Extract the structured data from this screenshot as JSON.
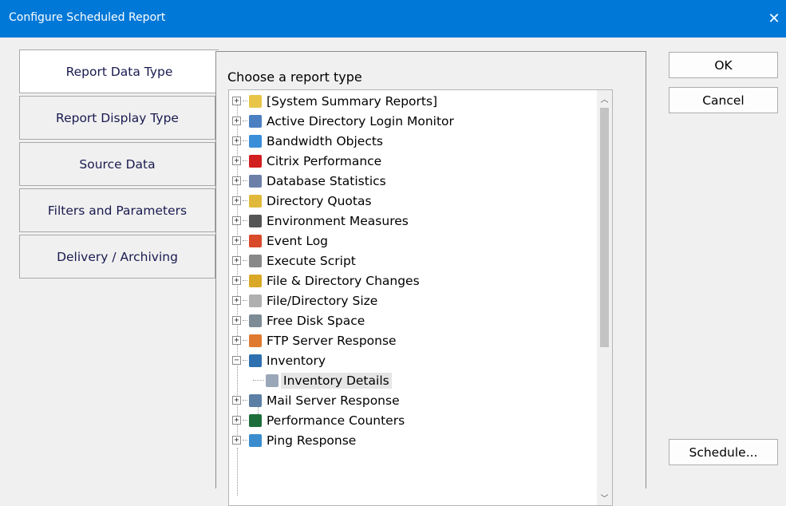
{
  "window": {
    "title": "Configure Scheduled Report"
  },
  "tabs": [
    {
      "label": "Report Data Type",
      "active": true
    },
    {
      "label": "Report Display Type",
      "active": false
    },
    {
      "label": "Source Data",
      "active": false
    },
    {
      "label": "Filters and Parameters",
      "active": false
    },
    {
      "label": "Delivery / Archiving",
      "active": false
    }
  ],
  "panel": {
    "heading": "Choose a report type"
  },
  "tree": {
    "items": [
      {
        "label": "[System Summary Reports]",
        "icon": "folder-icon",
        "color": "#e8c547",
        "expanded": false
      },
      {
        "label": "Active Directory Login Monitor",
        "icon": "directory-icon",
        "color": "#4a7fc1",
        "expanded": false
      },
      {
        "label": "Bandwidth Objects",
        "icon": "network-icon",
        "color": "#3b8ed8",
        "expanded": false
      },
      {
        "label": "Citrix Performance",
        "icon": "citrix-icon",
        "color": "#d21f1f",
        "expanded": false
      },
      {
        "label": "Database Statistics",
        "icon": "database-icon",
        "color": "#6b7fa8",
        "expanded": false
      },
      {
        "label": "Directory Quotas",
        "icon": "folder-icon",
        "color": "#e0b93a",
        "expanded": false
      },
      {
        "label": "Environment Measures",
        "icon": "chart-icon",
        "color": "#555555",
        "expanded": false
      },
      {
        "label": "Event Log",
        "icon": "event-log-icon",
        "color": "#d84a2a",
        "expanded": false
      },
      {
        "label": "Execute Script",
        "icon": "script-icon",
        "color": "#888888",
        "expanded": false
      },
      {
        "label": "File & Directory Changes",
        "icon": "folder-change-icon",
        "color": "#d9a826",
        "expanded": false
      },
      {
        "label": "File/Directory Size",
        "icon": "file-icon",
        "color": "#b0b0b0",
        "expanded": false
      },
      {
        "label": "Free Disk Space",
        "icon": "disk-icon",
        "color": "#7c8b96",
        "expanded": false
      },
      {
        "label": "FTP Server Response",
        "icon": "ftp-icon",
        "color": "#e07a2f",
        "expanded": false
      },
      {
        "label": "Inventory",
        "icon": "inventory-icon",
        "color": "#2e6fb0",
        "expanded": true
      },
      {
        "label": "Inventory Details",
        "icon": "report-icon",
        "color": "#9aa7b8",
        "child": true,
        "selected": true
      },
      {
        "label": "Mail Server Response",
        "icon": "mail-server-icon",
        "color": "#5b7fa5",
        "expanded": false
      },
      {
        "label": "Performance Counters",
        "icon": "performance-icon",
        "color": "#1d6e3a",
        "expanded": false
      },
      {
        "label": "Ping Response",
        "icon": "ping-icon",
        "color": "#3a8ccf",
        "expanded": false
      }
    ]
  },
  "buttons": {
    "ok": "OK",
    "cancel": "Cancel",
    "schedule": "Schedule..."
  },
  "colors": {
    "titlebar": "#0078d7",
    "tab_text": "#1a1a50",
    "selection": "#e5e5e5"
  }
}
